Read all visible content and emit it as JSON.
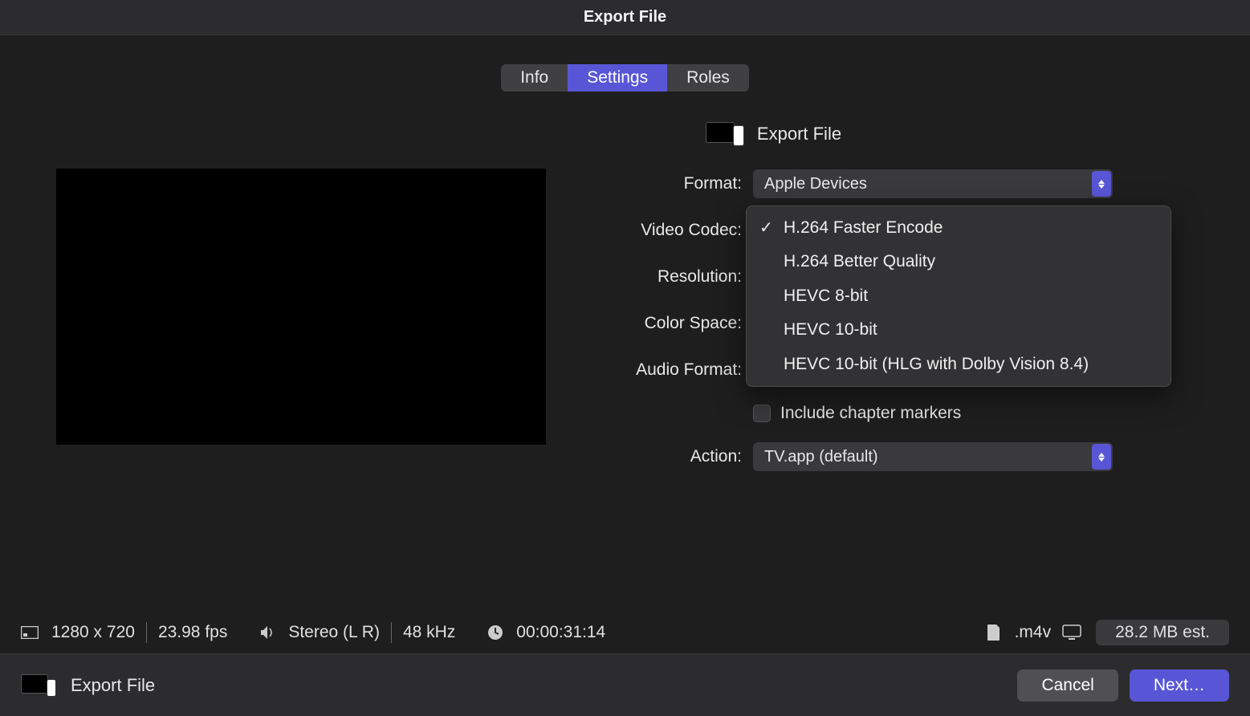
{
  "titlebar": {
    "title": "Export File"
  },
  "tabs": [
    {
      "label": "Info"
    },
    {
      "label": "Settings"
    },
    {
      "label": "Roles"
    }
  ],
  "header": {
    "title": "Export File"
  },
  "form": {
    "format_label": "Format:",
    "format_value": "Apple Devices",
    "video_codec_label": "Video Codec:",
    "resolution_label": "Resolution:",
    "color_space_label": "Color Space:",
    "audio_format_label": "Audio Format:",
    "chapter_label": "Include chapter markers",
    "action_label": "Action:",
    "action_value": "TV.app (default)"
  },
  "codec_options": [
    "H.264 Faster Encode",
    "H.264 Better Quality",
    "HEVC 8-bit",
    "HEVC 10-bit",
    "HEVC 10-bit (HLG with Dolby Vision 8.4)"
  ],
  "status": {
    "resolution": "1280 x 720",
    "fps": "23.98 fps",
    "audio": "Stereo (L R)",
    "samplerate": "48 kHz",
    "duration": "00:00:31:14",
    "extension": ".m4v",
    "size_est": "28.2 MB est."
  },
  "footer": {
    "title": "Export File",
    "cancel": "Cancel",
    "next": "Next…"
  }
}
